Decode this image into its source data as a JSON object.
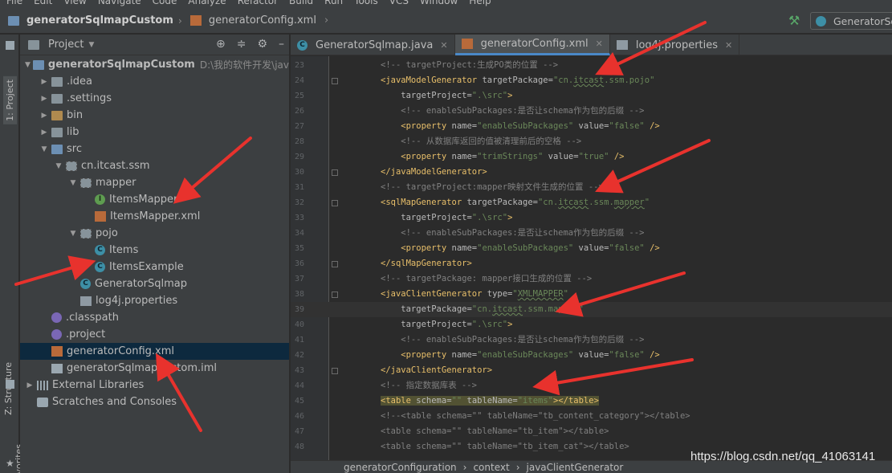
{
  "menu": [
    "File",
    "Edit",
    "View",
    "Navigate",
    "Code",
    "Analyze",
    "Refactor",
    "Build",
    "Run",
    "Tools",
    "VCS",
    "Window",
    "Help"
  ],
  "nav": {
    "project": "generatorSqlmapCustom",
    "file": "generatorConfig.xml",
    "run_config": "GeneratorSq"
  },
  "side_tabs": {
    "project": "1: Project",
    "structure": "Z: Structure",
    "favorites": "2: Favorites"
  },
  "project_panel": {
    "title": "Project",
    "tree": [
      {
        "label": "generatorSqlmapCustom",
        "extra": "D:\\我的软件开发\\java_we",
        "indent": 0,
        "arrow": "▼",
        "icon": "module"
      },
      {
        "label": ".idea",
        "indent": 1,
        "arrow": "▶",
        "icon": "folder"
      },
      {
        "label": ".settings",
        "indent": 1,
        "arrow": "▶",
        "icon": "folder"
      },
      {
        "label": "bin",
        "indent": 1,
        "arrow": "▶",
        "icon": "folder-bin"
      },
      {
        "label": "lib",
        "indent": 1,
        "arrow": "▶",
        "icon": "folder"
      },
      {
        "label": "src",
        "indent": 1,
        "arrow": "▼",
        "icon": "folder-src"
      },
      {
        "label": "cn.itcast.ssm",
        "indent": 2,
        "arrow": "▼",
        "icon": "pkg"
      },
      {
        "label": "mapper",
        "indent": 3,
        "arrow": "▼",
        "icon": "pkg"
      },
      {
        "label": "ItemsMapper",
        "indent": 4,
        "arrow": "",
        "icon": "iface"
      },
      {
        "label": "ItemsMapper.xml",
        "indent": 4,
        "arrow": "",
        "icon": "xml"
      },
      {
        "label": "pojo",
        "indent": 3,
        "arrow": "▼",
        "icon": "pkg"
      },
      {
        "label": "Items",
        "indent": 4,
        "arrow": "",
        "icon": "cls"
      },
      {
        "label": "ItemsExample",
        "indent": 4,
        "arrow": "",
        "icon": "cls"
      },
      {
        "label": "GeneratorSqlmap",
        "indent": 3,
        "arrow": "",
        "icon": "cls"
      },
      {
        "label": "log4j.properties",
        "indent": 3,
        "arrow": "",
        "icon": "props"
      },
      {
        "label": ".classpath",
        "indent": 1,
        "arrow": "",
        "icon": "dot"
      },
      {
        "label": ".project",
        "indent": 1,
        "arrow": "",
        "icon": "dot"
      },
      {
        "label": "generatorConfig.xml",
        "indent": 1,
        "arrow": "",
        "icon": "xml",
        "selected": true
      },
      {
        "label": "generatorSqlmapCustom.iml",
        "indent": 1,
        "arrow": "",
        "icon": "iml"
      },
      {
        "label": "External Libraries",
        "indent": 0,
        "arrow": "▶",
        "icon": "lib"
      },
      {
        "label": "Scratches and Consoles",
        "indent": 0,
        "arrow": "",
        "icon": "scratch"
      }
    ]
  },
  "tabs": [
    {
      "label": "GeneratorSqlmap.java",
      "icon": "cls",
      "active": false
    },
    {
      "label": "generatorConfig.xml",
      "icon": "xml",
      "active": true
    },
    {
      "label": "log4j.properties",
      "icon": "props",
      "active": false
    }
  ],
  "code_lines": [
    {
      "n": "23",
      "parts": [
        [
          "cm",
          "<!-- targetProject:生成PO类的位置 -->"
        ]
      ]
    },
    {
      "n": "24",
      "parts": [
        [
          "tg",
          "<javaModelGenerator "
        ],
        [
          "at",
          "targetPackage="
        ],
        [
          "vl",
          "\"cn."
        ],
        [
          "vl sq",
          "itcast"
        ],
        [
          "vl",
          ".ssm.pojo\""
        ]
      ]
    },
    {
      "n": "25",
      "parts": [
        [
          "at",
          "    targetProject="
        ],
        [
          "vl",
          "\".\\src\""
        ],
        [
          "tg",
          ">"
        ]
      ]
    },
    {
      "n": "26",
      "parts": [
        [
          "cm",
          "    <!-- enableSubPackages:是否让schema作为包的后缀 -->"
        ]
      ]
    },
    {
      "n": "27",
      "parts": [
        [
          "tg",
          "    <property "
        ],
        [
          "at",
          "name="
        ],
        [
          "vl",
          "\"enableSubPackages\""
        ],
        [
          "at",
          " value="
        ],
        [
          "vl",
          "\"false\""
        ],
        [
          "tg",
          " />"
        ]
      ]
    },
    {
      "n": "28",
      "parts": [
        [
          "cm",
          "    <!-- 从数据库返回的值被清理前后的空格 -->"
        ]
      ]
    },
    {
      "n": "29",
      "parts": [
        [
          "tg",
          "    <property "
        ],
        [
          "at",
          "name="
        ],
        [
          "vl",
          "\"trimStrings\""
        ],
        [
          "at",
          " value="
        ],
        [
          "vl",
          "\"true\""
        ],
        [
          "tg",
          " />"
        ]
      ]
    },
    {
      "n": "30",
      "parts": [
        [
          "tg",
          "</javaModelGenerator>"
        ]
      ]
    },
    {
      "n": "31",
      "parts": [
        [
          "cm",
          "<!-- targetProject:mapper映射文件生成的位置 -->"
        ]
      ]
    },
    {
      "n": "32",
      "parts": [
        [
          "tg",
          "<sqlMapGenerator "
        ],
        [
          "at",
          "targetPackage="
        ],
        [
          "vl",
          "\"cn."
        ],
        [
          "vl sq",
          "itcast"
        ],
        [
          "vl",
          ".ssm."
        ],
        [
          "vl sq",
          "mapper"
        ],
        [
          "vl",
          "\""
        ]
      ]
    },
    {
      "n": "33",
      "parts": [
        [
          "at",
          "    targetProject="
        ],
        [
          "vl",
          "\".\\src\""
        ],
        [
          "tg",
          ">"
        ]
      ]
    },
    {
      "n": "34",
      "parts": [
        [
          "cm",
          "    <!-- enableSubPackages:是否让schema作为包的后缀 -->"
        ]
      ]
    },
    {
      "n": "35",
      "parts": [
        [
          "tg",
          "    <property "
        ],
        [
          "at",
          "name="
        ],
        [
          "vl",
          "\"enableSubPackages\""
        ],
        [
          "at",
          " value="
        ],
        [
          "vl",
          "\"false\""
        ],
        [
          "tg",
          " />"
        ]
      ]
    },
    {
      "n": "36",
      "parts": [
        [
          "tg",
          "</sqlMapGenerator>"
        ]
      ]
    },
    {
      "n": "37",
      "parts": [
        [
          "cm",
          "<!-- targetPackage: mapper接口生成的位置 -->"
        ]
      ]
    },
    {
      "n": "38",
      "parts": [
        [
          "tg",
          "<javaClientGenerator "
        ],
        [
          "at",
          "type="
        ],
        [
          "vl",
          "\""
        ],
        [
          "vl sq",
          "XMLMAPPER"
        ],
        [
          "vl",
          "\""
        ]
      ]
    },
    {
      "n": "39",
      "caret": true,
      "parts": [
        [
          "at",
          "    targetPackage="
        ],
        [
          "vl",
          "\"cn."
        ],
        [
          "vl sq",
          "itcast"
        ],
        [
          "vl",
          ".ssm."
        ],
        [
          "vl",
          "mapper\""
        ]
      ]
    },
    {
      "n": "40",
      "parts": [
        [
          "at",
          "    targetProject="
        ],
        [
          "vl",
          "\".\\src\""
        ],
        [
          "tg",
          ">"
        ]
      ]
    },
    {
      "n": "41",
      "parts": [
        [
          "cm",
          "    <!-- enableSubPackages:是否让schema作为包的后缀 -->"
        ]
      ]
    },
    {
      "n": "42",
      "parts": [
        [
          "tg",
          "    <property "
        ],
        [
          "at",
          "name="
        ],
        [
          "vl",
          "\"enableSubPackages\""
        ],
        [
          "at",
          " value="
        ],
        [
          "vl",
          "\"false\""
        ],
        [
          "tg",
          " />"
        ]
      ]
    },
    {
      "n": "43",
      "parts": [
        [
          "tg",
          "</javaClientGenerator>"
        ]
      ]
    },
    {
      "n": "44",
      "parts": [
        [
          "cm",
          "<!-- 指定数据库表 -->"
        ]
      ]
    },
    {
      "n": "45",
      "parts": [
        [
          "tg hl-tag",
          "<table "
        ],
        [
          "at hl-tag",
          "schema="
        ],
        [
          "vl hl-tag",
          "\"\""
        ],
        [
          "at hl-tag",
          " tableName="
        ],
        [
          "vl hl-tag",
          "\"items\""
        ],
        [
          "tg hl-tag",
          "></table>"
        ]
      ]
    },
    {
      "n": "46",
      "parts": [
        [
          "cm",
          "<!--<table schema=\"\" tableName=\"tb_content_category\"></table>"
        ]
      ]
    },
    {
      "n": "47",
      "parts": [
        [
          "cm",
          "<table schema=\"\" tableName=\"tb_item\"></table>"
        ]
      ]
    },
    {
      "n": "48",
      "parts": [
        [
          "cm",
          "<table schema=\"\" tableName=\"tb_item_cat\"></table>"
        ]
      ]
    }
  ],
  "breadcrumb_bottom": [
    "generatorConfiguration",
    "context",
    "javaClientGenerator"
  ],
  "watermark": "https://blog.csdn.net/qq_41063141",
  "colors": {
    "background": "#2b2b2b",
    "panel": "#3c3f41",
    "selection": "#0d293e",
    "annotation": "#e8322d"
  }
}
